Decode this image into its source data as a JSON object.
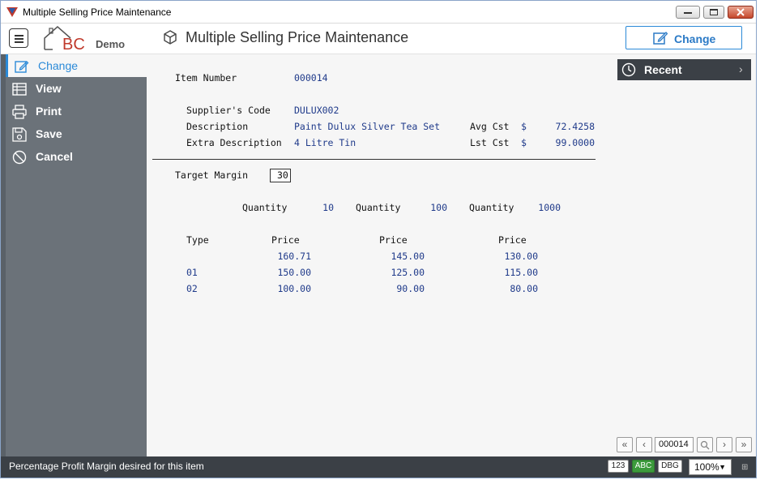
{
  "window": {
    "title": "Multiple Selling Price Maintenance"
  },
  "header": {
    "logo_text": "BC",
    "logo_sub": "Demo",
    "page_title": "Multiple Selling Price Maintenance",
    "change_button": "Change"
  },
  "sidebar": {
    "items": [
      {
        "label": "Change",
        "icon": "edit-icon"
      },
      {
        "label": "View",
        "icon": "table-icon"
      },
      {
        "label": "Print",
        "icon": "printer-icon"
      },
      {
        "label": "Save",
        "icon": "save-icon"
      },
      {
        "label": "Cancel",
        "icon": "cancel-icon"
      }
    ]
  },
  "form": {
    "item_number_label": "Item Number",
    "item_number": "000014",
    "supplier_code_label": "Supplier's Code",
    "supplier_code": "DULUX002",
    "description_label": "Description",
    "description": "Paint Dulux Silver Tea Set",
    "extra_description_label": "Extra Description",
    "extra_description": "4 Litre Tin",
    "avg_cst_label": "Avg Cst",
    "avg_cst_currency": "$",
    "avg_cst": "72.4258",
    "lst_cst_label": "Lst Cst",
    "lst_cst_currency": "$",
    "lst_cst": "99.0000",
    "target_margin_label": "Target Margin",
    "target_margin": "30"
  },
  "quantities": {
    "label": "Quantity",
    "values": [
      "10",
      "100",
      "1000"
    ]
  },
  "price_table": {
    "type_header": "Type",
    "price_header": "Price",
    "rows": [
      {
        "type": "",
        "prices": [
          "160.71",
          "145.00",
          "130.00"
        ]
      },
      {
        "type": "01",
        "prices": [
          "150.00",
          "125.00",
          "115.00"
        ]
      },
      {
        "type": "02",
        "prices": [
          "100.00",
          "90.00",
          "80.00"
        ]
      }
    ]
  },
  "recent": {
    "label": "Recent"
  },
  "pager": {
    "current": "000014"
  },
  "statusbar": {
    "message": "Percentage Profit Margin desired for this item",
    "badge_123": "123",
    "badge_abc": "ABC",
    "badge_dbg": "DBG",
    "zoom": "100%"
  },
  "colors": {
    "accent": "#2b8ad8",
    "sidebar": "#6b7279",
    "dark_bar": "#3b4046",
    "value_text": "#1f3a8a"
  }
}
